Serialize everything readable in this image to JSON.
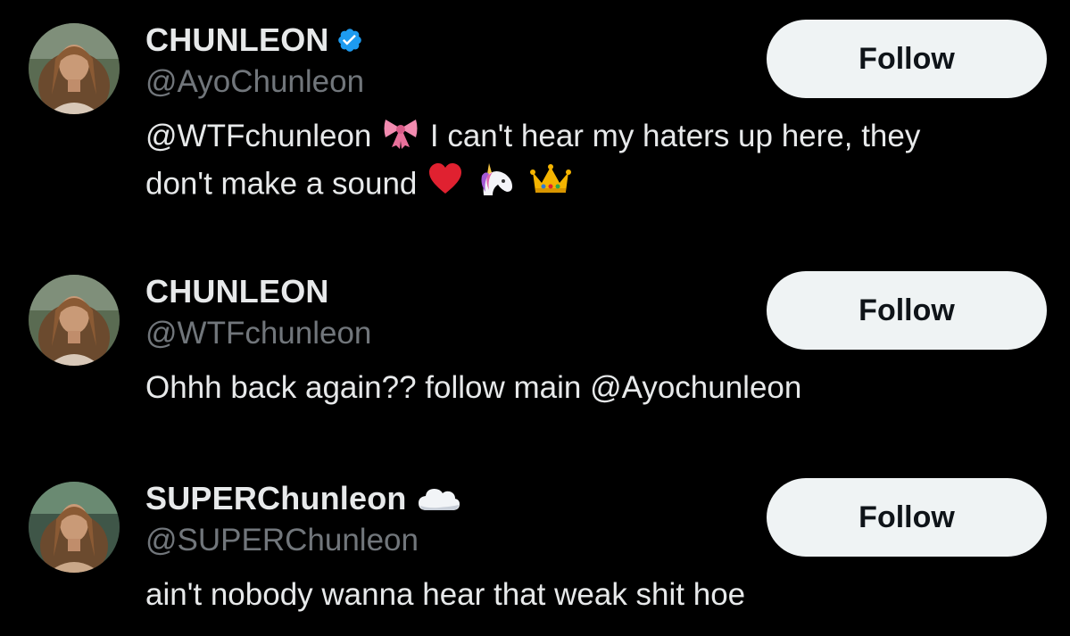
{
  "accounts": [
    {
      "display_name": "CHUNLEON",
      "badge_icon": "verified-badge-icon",
      "handle": "@AyoChunleon",
      "bio_parts": {
        "part1": "@WTFchunleon",
        "part2": "I can't hear my haters up here, they",
        "part3": "don't make a sound"
      },
      "bio_emojis": [
        "ribbon-emoji",
        "red-heart-emoji",
        "unicorn-emoji",
        "crown-emoji"
      ],
      "follow_label": "Follow"
    },
    {
      "display_name": "CHUNLEON",
      "handle": "@WTFchunleon",
      "bio": "Ohhh back again?? follow main @Ayochunleon",
      "follow_label": "Follow"
    },
    {
      "display_name": "SUPERChunleon",
      "badge_icon": "cloud-emoji",
      "handle": "@SUPERChunleon",
      "bio": "ain't nobody wanna hear that weak shit hoe",
      "follow_label": "Follow"
    }
  ],
  "colors": {
    "background": "#000000",
    "primary_text": "#e7e9ea",
    "secondary_text": "#71767b",
    "verified_blue": "#1d9bf0",
    "follow_button_bg": "#eff3f4",
    "follow_button_text": "#0f1419"
  }
}
